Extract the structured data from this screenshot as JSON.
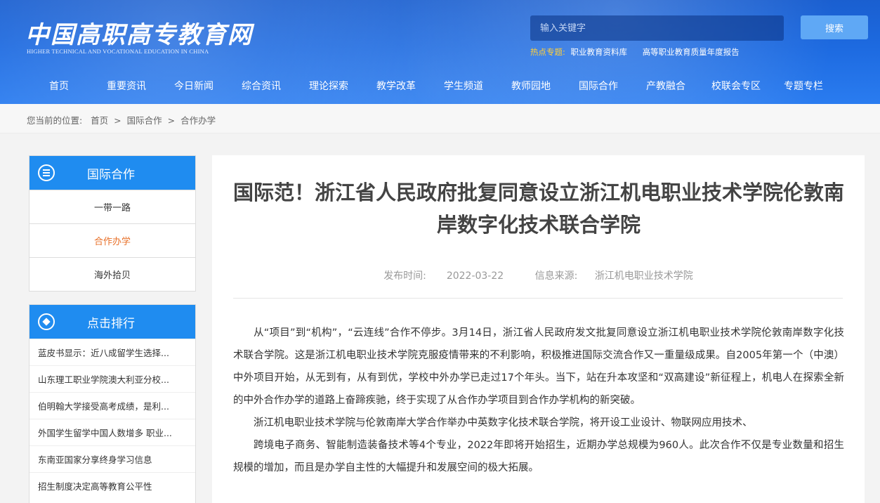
{
  "header": {
    "logo_cn": "中国高职高专教育网",
    "logo_en": "HIGHER TECHNICAL AND VOCATIONAL EDUCATION IN CHINA",
    "search_placeholder": "输入关键字",
    "search_button": "搜索",
    "hot_label": "热点专题:",
    "hot_links": [
      "职业教育资料库",
      "高等职业教育质量年度报告"
    ]
  },
  "nav": [
    "首页",
    "重要资讯",
    "今日新闻",
    "综合资讯",
    "理论探索",
    "教学改革",
    "学生频道",
    "教师园地",
    "国际合作",
    "产教融合",
    "校联会专区",
    "专题专栏"
  ],
  "breadcrumb": {
    "prefix": "您当前的位置:",
    "items": [
      "首页",
      "国际合作",
      "合作办学"
    ],
    "sep": ">"
  },
  "sidebar": {
    "category_title": "国际合作",
    "category_icon": "list-icon",
    "links": [
      {
        "label": "一带一路",
        "active": false
      },
      {
        "label": "合作办学",
        "active": true
      },
      {
        "label": "海外拾贝",
        "active": false
      }
    ],
    "rank_title": "点击排行",
    "rank_icon": "rank-icon",
    "rank_items": [
      "蓝皮书显示：近八成留学生选择...",
      "山东理工职业学院澳大利亚分校...",
      "伯明翰大学接受高考成绩，是利...",
      "外国学生留学中国人数增多 职业...",
      "东南亚国家分享终身学习信息",
      "招生制度决定高等教育公平性"
    ]
  },
  "article": {
    "title": "国际范！浙江省人民政府批复同意设立浙江机电职业技术学院伦敦南岸数字化技术联合学院",
    "publish_label": "发布时间:",
    "publish_date": "2022-03-22",
    "source_label": "信息来源:",
    "source": "浙江机电职业技术学院",
    "paragraphs": [
      "从“项目”到“机构”，“云连线”合作不停步。3月14日，浙江省人民政府发文批复同意设立浙江机电职业技术学院伦敦南岸数字化技术联合学院。这是浙江机电职业技术学院克服疫情带来的不利影响，积极推进国际交流合作又一重量级成果。自2005年第一个（中澳）中外项目开始，从无到有，从有到优，学校中外办学已走过17个年头。当下，站在升本攻坚和“双高建设”新征程上，机电人在探索全新的中外合作办学的道路上奋蹄疾驰，终于实现了从合作办学项目到合作办学机构的新突破。",
      "浙江机电职业技术学院与伦敦南岸大学合作举办中英数字化技术联合学院，将开设工业设计、物联网应用技术、",
      "跨境电子商务、智能制造装备技术等4个专业，2022年即将开始招生，近期办学总规模为960人。此次合作不仅是专业数量和招生规模的增加，而且是办学自主性的大幅提升和发展空间的极大拓展。"
    ]
  },
  "colors": {
    "header_blue": "#1d6ae0",
    "accent_blue": "#1f8cf0",
    "active_orange": "#e8712a",
    "hot_yellow": "#ffcf3a"
  }
}
